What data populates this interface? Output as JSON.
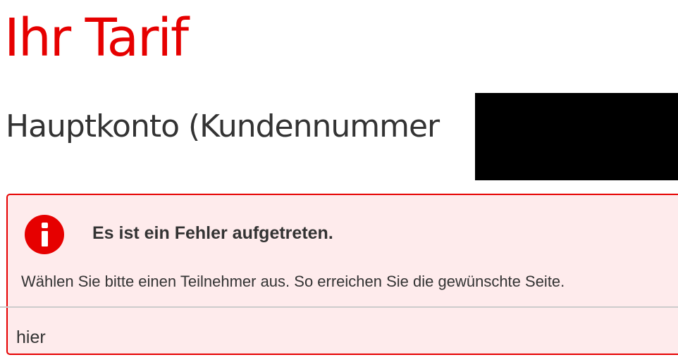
{
  "page": {
    "title": "Ihr Tarif",
    "subtitle": "Hauptkonto (Kundennummer"
  },
  "alert": {
    "icon": "info-alert-icon",
    "heading": "Es ist ein Fehler aufgetreten.",
    "message": "Wählen Sie bitte einen Teilnehmer aus. So erreichen Sie die gewünschte Seite.",
    "link_label": "hier"
  },
  "colors": {
    "brand_red": "#e60000",
    "alert_background": "#feebec",
    "text": "#333333",
    "redaction": "#000000"
  }
}
